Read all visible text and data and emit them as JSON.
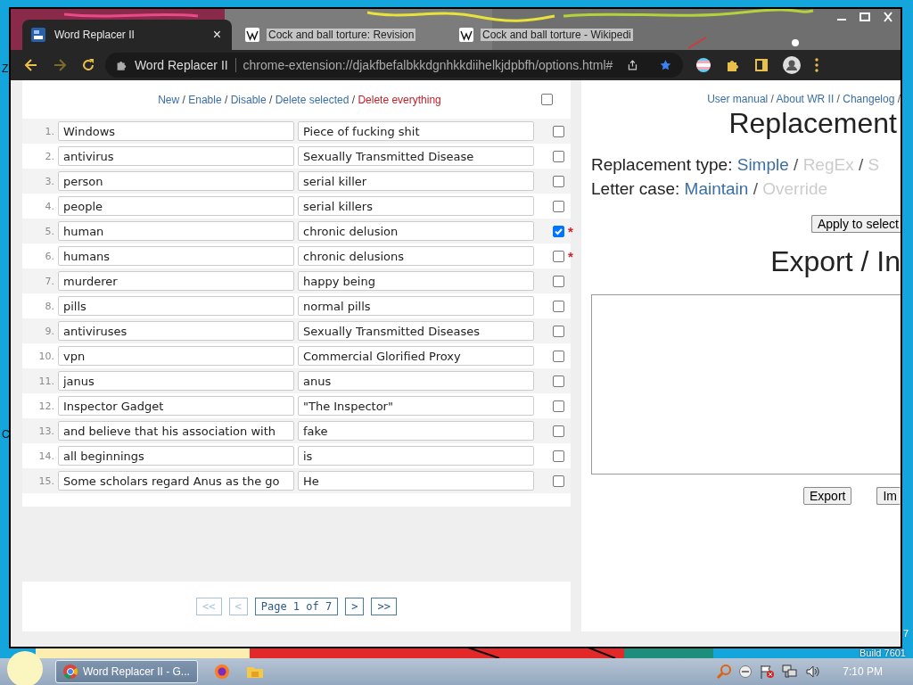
{
  "desktop": {
    "texts": [
      {
        "text": "Z",
        "kind": "edge-left"
      },
      {
        "text": "C",
        "kind": "edge-left"
      },
      {
        "text": "7",
        "kind": "edge-right"
      },
      {
        "text": "Build 7601",
        "kind": "build"
      }
    ]
  },
  "browser": {
    "tabs": [
      {
        "title": "Word Replacer II",
        "selected": true,
        "kind": "app",
        "close": "×"
      },
      {
        "title": "Cock and ball torture: Revision",
        "selected": false,
        "kind": "wiki"
      },
      {
        "title": "Cock and ball torture - Wikipedi",
        "selected": false,
        "kind": "wiki"
      }
    ],
    "omnibox": {
      "site": "Word Replacer II",
      "url": "chrome-extension://djakfbefalbkkdgnhkkdiihelkjdpbfh/options.html#"
    }
  },
  "toolbar": {
    "separator": "/",
    "links": [
      {
        "label": "New",
        "kind": "action"
      },
      {
        "label": "Enable",
        "kind": "action"
      },
      {
        "label": "Disable",
        "kind": "action"
      },
      {
        "label": "Delete selected",
        "kind": "action"
      },
      {
        "label": "Delete everything",
        "kind": "danger"
      }
    ],
    "select_all": {
      "checked": false
    }
  },
  "rules": [
    {
      "number": "1.",
      "from": "Windows",
      "to": "Piece of fucking shit",
      "checked": false
    },
    {
      "number": "2.",
      "from": "antivirus",
      "to": "Sexually Transmitted Disease",
      "checked": false
    },
    {
      "number": "3.",
      "from": "person",
      "to": "serial killer",
      "checked": false
    },
    {
      "number": "4.",
      "from": "people",
      "to": "serial killers",
      "checked": false
    },
    {
      "number": "5.",
      "from": "human",
      "to": "chronic delusion",
      "checked": true,
      "flag": "*"
    },
    {
      "number": "6.",
      "from": "humans",
      "to": "chronic delusions",
      "checked": false,
      "flag": "*"
    },
    {
      "number": "7.",
      "from": "murderer",
      "to": "happy being",
      "checked": false
    },
    {
      "number": "8.",
      "from": "pills",
      "to": "normal pills",
      "checked": false
    },
    {
      "number": "9.",
      "from": "antiviruses",
      "to": "Sexually Transmitted Diseases",
      "checked": false
    },
    {
      "number": "10.",
      "from": "vpn",
      "to": "Commercial Glorified Proxy",
      "checked": false
    },
    {
      "number": "11.",
      "from": "janus",
      "to": "anus",
      "checked": false
    },
    {
      "number": "12.",
      "from": "Inspector Gadget",
      "to": "\"The Inspector\"",
      "checked": false
    },
    {
      "number": "13.",
      "from": "and believe that his association with",
      "to": "fake",
      "checked": false
    },
    {
      "number": "14.",
      "from": "all beginnings",
      "to": "is",
      "checked": false
    },
    {
      "number": "15.",
      "from": "Some scholars regard Anus as the go",
      "to": "He",
      "checked": false
    }
  ],
  "pagination": [
    {
      "label": "<<",
      "kind": "page",
      "disabled": true
    },
    {
      "label": "<",
      "kind": "page",
      "disabled": true
    },
    {
      "label": "Page 1 of 7",
      "kind": "status"
    },
    {
      "label": ">",
      "kind": "page",
      "disabled": false
    },
    {
      "label": ">>",
      "kind": "page",
      "disabled": false
    }
  ],
  "side": {
    "separator": "/",
    "links": [
      "User manual",
      "About WR II",
      "Changelog"
    ],
    "heading": "Replacement",
    "type_label": "Replacement type:",
    "type_options": [
      {
        "label": "Simple",
        "selected": true
      },
      {
        "label": "RegEx",
        "selected": false
      },
      {
        "label": "S",
        "selected": false
      }
    ],
    "case_label": "Letter case:",
    "case_options": [
      {
        "label": "Maintain",
        "selected": true
      },
      {
        "label": "Override",
        "selected": false
      }
    ],
    "apply_button": "Apply to select",
    "export_heading": "Export / In",
    "buttons": [
      "Export",
      "Im"
    ]
  },
  "taskbar": {
    "window_button": "Word Replacer II - G...",
    "clock": "7:10 PM"
  }
}
